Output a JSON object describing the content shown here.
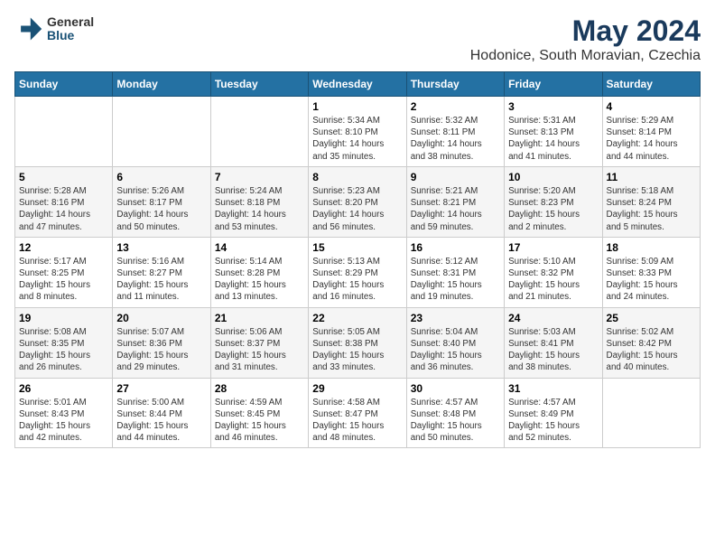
{
  "logo": {
    "general": "General",
    "blue": "Blue"
  },
  "title": "May 2024",
  "subtitle": "Hodonice, South Moravian, Czechia",
  "days_of_week": [
    "Sunday",
    "Monday",
    "Tuesday",
    "Wednesday",
    "Thursday",
    "Friday",
    "Saturday"
  ],
  "weeks": [
    [
      {
        "day": "",
        "info": ""
      },
      {
        "day": "",
        "info": ""
      },
      {
        "day": "",
        "info": ""
      },
      {
        "day": "1",
        "info": "Sunrise: 5:34 AM\nSunset: 8:10 PM\nDaylight: 14 hours\nand 35 minutes."
      },
      {
        "day": "2",
        "info": "Sunrise: 5:32 AM\nSunset: 8:11 PM\nDaylight: 14 hours\nand 38 minutes."
      },
      {
        "day": "3",
        "info": "Sunrise: 5:31 AM\nSunset: 8:13 PM\nDaylight: 14 hours\nand 41 minutes."
      },
      {
        "day": "4",
        "info": "Sunrise: 5:29 AM\nSunset: 8:14 PM\nDaylight: 14 hours\nand 44 minutes."
      }
    ],
    [
      {
        "day": "5",
        "info": "Sunrise: 5:28 AM\nSunset: 8:16 PM\nDaylight: 14 hours\nand 47 minutes."
      },
      {
        "day": "6",
        "info": "Sunrise: 5:26 AM\nSunset: 8:17 PM\nDaylight: 14 hours\nand 50 minutes."
      },
      {
        "day": "7",
        "info": "Sunrise: 5:24 AM\nSunset: 8:18 PM\nDaylight: 14 hours\nand 53 minutes."
      },
      {
        "day": "8",
        "info": "Sunrise: 5:23 AM\nSunset: 8:20 PM\nDaylight: 14 hours\nand 56 minutes."
      },
      {
        "day": "9",
        "info": "Sunrise: 5:21 AM\nSunset: 8:21 PM\nDaylight: 14 hours\nand 59 minutes."
      },
      {
        "day": "10",
        "info": "Sunrise: 5:20 AM\nSunset: 8:23 PM\nDaylight: 15 hours\nand 2 minutes."
      },
      {
        "day": "11",
        "info": "Sunrise: 5:18 AM\nSunset: 8:24 PM\nDaylight: 15 hours\nand 5 minutes."
      }
    ],
    [
      {
        "day": "12",
        "info": "Sunrise: 5:17 AM\nSunset: 8:25 PM\nDaylight: 15 hours\nand 8 minutes."
      },
      {
        "day": "13",
        "info": "Sunrise: 5:16 AM\nSunset: 8:27 PM\nDaylight: 15 hours\nand 11 minutes."
      },
      {
        "day": "14",
        "info": "Sunrise: 5:14 AM\nSunset: 8:28 PM\nDaylight: 15 hours\nand 13 minutes."
      },
      {
        "day": "15",
        "info": "Sunrise: 5:13 AM\nSunset: 8:29 PM\nDaylight: 15 hours\nand 16 minutes."
      },
      {
        "day": "16",
        "info": "Sunrise: 5:12 AM\nSunset: 8:31 PM\nDaylight: 15 hours\nand 19 minutes."
      },
      {
        "day": "17",
        "info": "Sunrise: 5:10 AM\nSunset: 8:32 PM\nDaylight: 15 hours\nand 21 minutes."
      },
      {
        "day": "18",
        "info": "Sunrise: 5:09 AM\nSunset: 8:33 PM\nDaylight: 15 hours\nand 24 minutes."
      }
    ],
    [
      {
        "day": "19",
        "info": "Sunrise: 5:08 AM\nSunset: 8:35 PM\nDaylight: 15 hours\nand 26 minutes."
      },
      {
        "day": "20",
        "info": "Sunrise: 5:07 AM\nSunset: 8:36 PM\nDaylight: 15 hours\nand 29 minutes."
      },
      {
        "day": "21",
        "info": "Sunrise: 5:06 AM\nSunset: 8:37 PM\nDaylight: 15 hours\nand 31 minutes."
      },
      {
        "day": "22",
        "info": "Sunrise: 5:05 AM\nSunset: 8:38 PM\nDaylight: 15 hours\nand 33 minutes."
      },
      {
        "day": "23",
        "info": "Sunrise: 5:04 AM\nSunset: 8:40 PM\nDaylight: 15 hours\nand 36 minutes."
      },
      {
        "day": "24",
        "info": "Sunrise: 5:03 AM\nSunset: 8:41 PM\nDaylight: 15 hours\nand 38 minutes."
      },
      {
        "day": "25",
        "info": "Sunrise: 5:02 AM\nSunset: 8:42 PM\nDaylight: 15 hours\nand 40 minutes."
      }
    ],
    [
      {
        "day": "26",
        "info": "Sunrise: 5:01 AM\nSunset: 8:43 PM\nDaylight: 15 hours\nand 42 minutes."
      },
      {
        "day": "27",
        "info": "Sunrise: 5:00 AM\nSunset: 8:44 PM\nDaylight: 15 hours\nand 44 minutes."
      },
      {
        "day": "28",
        "info": "Sunrise: 4:59 AM\nSunset: 8:45 PM\nDaylight: 15 hours\nand 46 minutes."
      },
      {
        "day": "29",
        "info": "Sunrise: 4:58 AM\nSunset: 8:47 PM\nDaylight: 15 hours\nand 48 minutes."
      },
      {
        "day": "30",
        "info": "Sunrise: 4:57 AM\nSunset: 8:48 PM\nDaylight: 15 hours\nand 50 minutes."
      },
      {
        "day": "31",
        "info": "Sunrise: 4:57 AM\nSunset: 8:49 PM\nDaylight: 15 hours\nand 52 minutes."
      },
      {
        "day": "",
        "info": ""
      }
    ]
  ]
}
